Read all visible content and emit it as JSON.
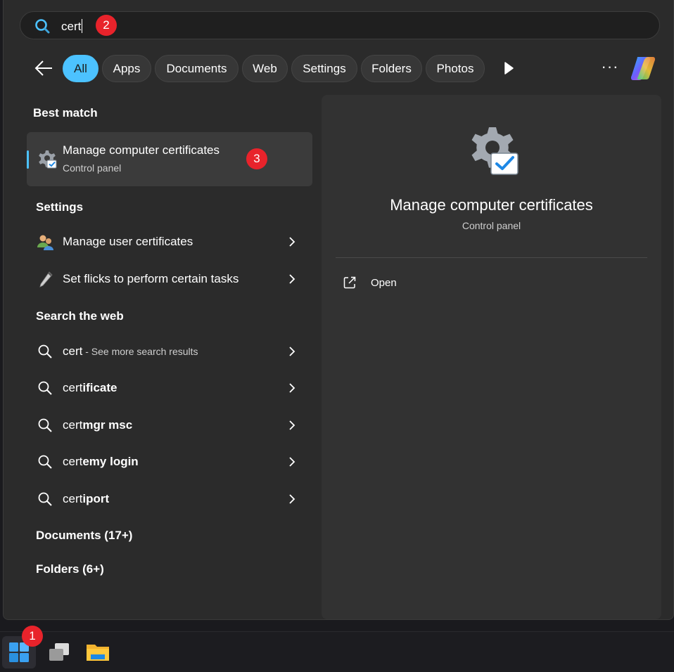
{
  "search": {
    "query": "cert"
  },
  "badges": {
    "one": "1",
    "two": "2",
    "three": "3"
  },
  "filters": [
    "All",
    "Apps",
    "Documents",
    "Web",
    "Settings",
    "Folders",
    "Photos"
  ],
  "icons": {
    "search": "search-icon",
    "back": "back-arrow-icon",
    "play": "play-icon",
    "more": "more-icon",
    "copilot": "copilot-icon",
    "gear_check": "gear-check-icon",
    "users": "users-icon",
    "pen": "pen-icon",
    "chevron": "chevron-right-icon",
    "open": "open-external-icon",
    "windows": "windows-start-icon",
    "task_view": "task-view-icon",
    "explorer": "file-explorer-icon"
  },
  "colors": {
    "accent": "#4cc2ff",
    "badge": "#e8232b",
    "panel": "#2b2b2b",
    "preview": "#323232"
  },
  "sections": {
    "best_match": "Best match",
    "settings": "Settings",
    "search_web": "Search the web",
    "documents": "Documents (17+)",
    "folders": "Folders (6+)"
  },
  "best_match": {
    "title": "Manage computer certificates",
    "subtitle": "Control panel"
  },
  "settings_items": [
    {
      "label": "Manage user certificates"
    },
    {
      "label": "Set flicks to perform certain tasks"
    }
  ],
  "web_results": [
    {
      "prefix": "cert",
      "bold": "",
      "suffix": " - See more search results"
    },
    {
      "prefix": "cert",
      "bold": "ificate",
      "suffix": ""
    },
    {
      "prefix": "cert",
      "bold": "mgr msc",
      "suffix": ""
    },
    {
      "prefix": "cert",
      "bold": "emy login",
      "suffix": ""
    },
    {
      "prefix": "cert",
      "bold": "iport",
      "suffix": ""
    }
  ],
  "preview": {
    "title": "Manage computer certificates",
    "subtitle": "Control panel",
    "open_label": "Open"
  }
}
